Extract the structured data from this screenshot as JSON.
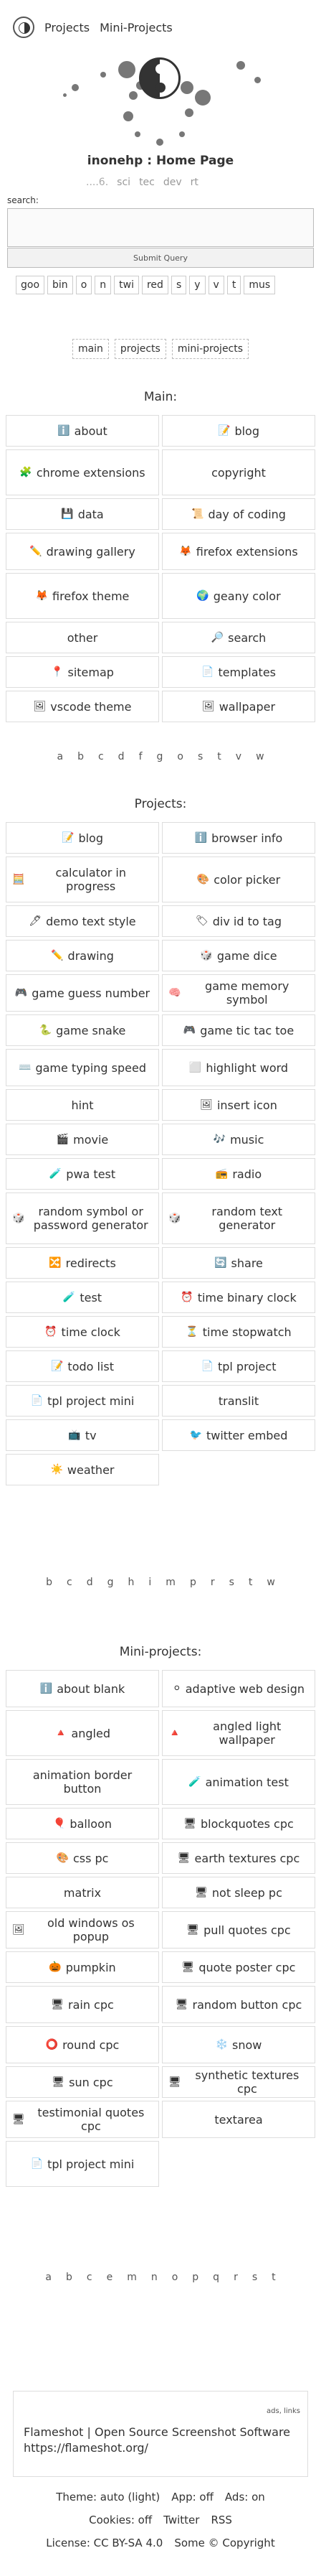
{
  "nav": {
    "projects": "Projects",
    "mini": "Mini-Projects"
  },
  "page_title": "inonehp : Home Page",
  "subnav": {
    "dots": "....6.",
    "sci": "sci",
    "tec": "tec",
    "dev": "dev",
    "rt": "rt"
  },
  "search": {
    "label": "search:",
    "button": "Submit Query"
  },
  "tags": [
    "goo",
    "bin",
    "o",
    "n",
    "twi",
    "red",
    "s",
    "y",
    "v",
    "t",
    "mus"
  ],
  "sections": [
    "main",
    "projects",
    "mini-projects"
  ],
  "main": {
    "heading": "Main:",
    "items": [
      {
        "label": "about",
        "icon": "ℹ️"
      },
      {
        "label": "blog",
        "icon": "📝"
      },
      {
        "label": "chrome extensions",
        "icon": "🧩"
      },
      {
        "label": "copyright",
        "icon": ""
      },
      {
        "label": "data",
        "icon": "💾"
      },
      {
        "label": "day of coding",
        "icon": "📜"
      },
      {
        "label": "drawing gallery",
        "icon": "✏️"
      },
      {
        "label": "firefox extensions",
        "icon": "🦊"
      },
      {
        "label": "firefox theme",
        "icon": "🦊"
      },
      {
        "label": "geany color",
        "icon": "🌍"
      },
      {
        "label": "other",
        "icon": ""
      },
      {
        "label": "search",
        "icon": "🔎"
      },
      {
        "label": "sitemap",
        "icon": "📍"
      },
      {
        "label": "templates",
        "icon": "📄"
      },
      {
        "label": "vscode theme",
        "icon": "🖼"
      },
      {
        "label": "wallpaper",
        "icon": "🖼"
      }
    ],
    "alpha": [
      "a",
      "b",
      "c",
      "d",
      "f",
      "g",
      "o",
      "s",
      "t",
      "v",
      "w"
    ]
  },
  "projects": {
    "heading": "Projects:",
    "items": [
      {
        "label": "blog",
        "icon": "📝"
      },
      {
        "label": "browser info",
        "icon": "ℹ️"
      },
      {
        "label": "calculator in progress",
        "icon": "🧮"
      },
      {
        "label": "color picker",
        "icon": "🎨"
      },
      {
        "label": "demo text style",
        "icon": "🖊"
      },
      {
        "label": "div id to tag",
        "icon": "🏷"
      },
      {
        "label": "drawing",
        "icon": "✏️"
      },
      {
        "label": "game dice",
        "icon": "🎲"
      },
      {
        "label": "game guess number",
        "icon": "🎮"
      },
      {
        "label": "game memory symbol",
        "icon": "🧠"
      },
      {
        "label": "game snake",
        "icon": "🐍"
      },
      {
        "label": "game tic tac toe",
        "icon": "🎮"
      },
      {
        "label": "game typing speed",
        "icon": "⌨️"
      },
      {
        "label": "highlight word",
        "icon": "⬜"
      },
      {
        "label": "hint",
        "icon": ""
      },
      {
        "label": "insert icon",
        "icon": "🖼"
      },
      {
        "label": "movie",
        "icon": "🎬"
      },
      {
        "label": "music",
        "icon": "🎶"
      },
      {
        "label": "pwa test",
        "icon": "🧪"
      },
      {
        "label": "radio",
        "icon": "📻"
      },
      {
        "label": "random symbol or password generator",
        "icon": "🎲"
      },
      {
        "label": "random text generator",
        "icon": "🎲"
      },
      {
        "label": "redirects",
        "icon": "🔀"
      },
      {
        "label": "share",
        "icon": "🔄"
      },
      {
        "label": "test",
        "icon": "🧪"
      },
      {
        "label": "time binary clock",
        "icon": "⏰"
      },
      {
        "label": "time clock",
        "icon": "⏰"
      },
      {
        "label": "time stopwatch",
        "icon": "⏳"
      },
      {
        "label": "todo list",
        "icon": "📝"
      },
      {
        "label": "tpl project",
        "icon": "📄"
      },
      {
        "label": "tpl project mini",
        "icon": "📄"
      },
      {
        "label": "translit",
        "icon": ""
      },
      {
        "label": "tv",
        "icon": "📺"
      },
      {
        "label": "twitter embed",
        "icon": "🐦"
      },
      {
        "label": "weather",
        "icon": "☀️"
      }
    ],
    "alpha": [
      "b",
      "c",
      "d",
      "g",
      "h",
      "i",
      "m",
      "p",
      "r",
      "s",
      "t",
      "w"
    ]
  },
  "mini": {
    "heading": "Mini-projects:",
    "items": [
      {
        "label": "about blank",
        "icon": "ℹ️"
      },
      {
        "label": "adaptive web design",
        "icon": "⚪"
      },
      {
        "label": "angled",
        "icon": "🔺"
      },
      {
        "label": "angled light wallpaper",
        "icon": "🔺"
      },
      {
        "label": "animation border button",
        "icon": ""
      },
      {
        "label": "animation test",
        "icon": "🧪"
      },
      {
        "label": "balloon",
        "icon": "🎈"
      },
      {
        "label": "blockquotes cpc",
        "icon": "🖥"
      },
      {
        "label": "css pc",
        "icon": "🎨"
      },
      {
        "label": "earth textures cpc",
        "icon": "🖥"
      },
      {
        "label": "matrix",
        "icon": ""
      },
      {
        "label": "not sleep pc",
        "icon": "🖥"
      },
      {
        "label": "old windows os popup",
        "icon": "🖼"
      },
      {
        "label": "pull quotes cpc",
        "icon": "🖥"
      },
      {
        "label": "pumpkin",
        "icon": "🎃"
      },
      {
        "label": "quote poster cpc",
        "icon": "🖥"
      },
      {
        "label": "rain cpc",
        "icon": "🖥"
      },
      {
        "label": "random button cpc",
        "icon": "🖥"
      },
      {
        "label": "round cpc",
        "icon": "⭕"
      },
      {
        "label": "snow",
        "icon": "❄️"
      },
      {
        "label": "sun cpc",
        "icon": "🖥"
      },
      {
        "label": "synthetic textures cpc",
        "icon": "🖥"
      },
      {
        "label": "testimonial quotes cpc",
        "icon": "🖥"
      },
      {
        "label": "textarea",
        "icon": ""
      },
      {
        "label": "tpl project mini",
        "icon": "📄"
      }
    ],
    "alpha": [
      "a",
      "b",
      "c",
      "e",
      "m",
      "n",
      "o",
      "p",
      "q",
      "r",
      "s",
      "t"
    ]
  },
  "ad": {
    "small": "ads, links",
    "text": "Flameshot | Open Source Screenshot Software https://flameshot.org/"
  },
  "footer": {
    "line1": [
      "Theme: auto (light)",
      "App: off",
      "Ads: on"
    ],
    "line2": [
      "Cookies: off",
      "Twitter",
      "RSS"
    ],
    "line3": [
      "License: CC BY-SA 4.0",
      "Some © Copyright"
    ]
  }
}
